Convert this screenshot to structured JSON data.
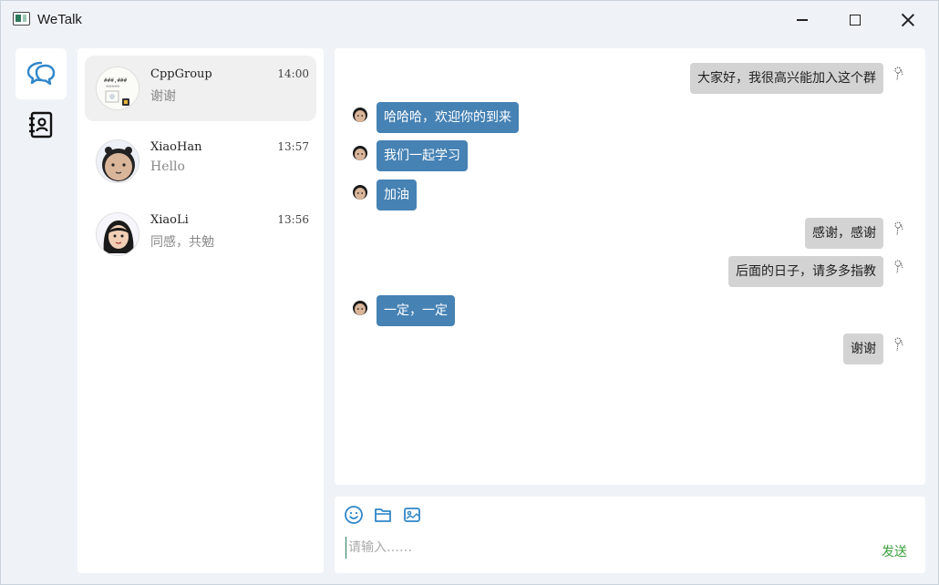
{
  "window": {
    "title": "WeTalk"
  },
  "nav": {
    "items": [
      {
        "icon": "chat-bubbles-icon",
        "active": true
      },
      {
        "icon": "contacts-book-icon",
        "active": false
      }
    ]
  },
  "conversations": [
    {
      "name": "CppGroup",
      "time": "14:00",
      "preview": "谢谢",
      "active": true
    },
    {
      "name": "XiaoHan",
      "time": "13:57",
      "preview": "Hello",
      "active": false
    },
    {
      "name": "XiaoLi",
      "time": "13:56",
      "preview": "同感，共勉",
      "active": false
    }
  ],
  "messages": [
    {
      "from": "me",
      "text": "大家好，我很高兴能加入这个群"
    },
    {
      "from": "other",
      "text": "哈哈哈，欢迎你的到来"
    },
    {
      "from": "other",
      "text": "我们一起学习"
    },
    {
      "from": "other",
      "text": "加油"
    },
    {
      "from": "me",
      "text": "感谢，感谢"
    },
    {
      "from": "me",
      "text": "后面的日子，请多多指教"
    },
    {
      "from": "other",
      "text": "一定，一定"
    },
    {
      "from": "me",
      "text": "谢谢"
    }
  ],
  "composer": {
    "tools": [
      "emoji-icon",
      "folder-icon",
      "image-icon"
    ],
    "placeholder": "请输入……",
    "value": "",
    "send_label": "发送"
  },
  "colors": {
    "incoming_bubble": "#4682b4",
    "outgoing_bubble": "#d3d3d3",
    "send_text": "#3aa03a",
    "nav_accent": "#2f86c9"
  }
}
